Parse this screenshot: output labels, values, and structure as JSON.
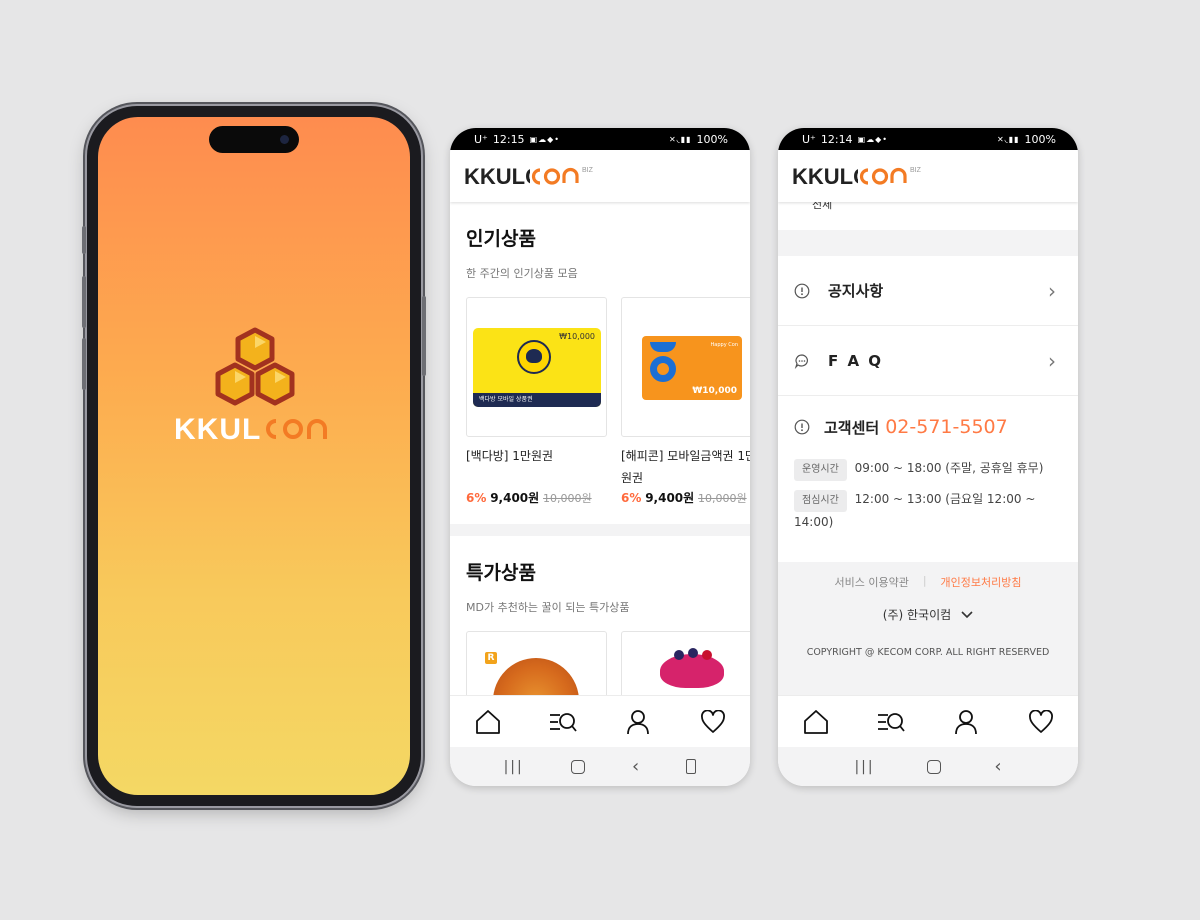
{
  "splash": {
    "brand": "KKULCON"
  },
  "screen2": {
    "status": {
      "carrier": "U⁺",
      "time": "12:15",
      "battery": "100%"
    },
    "logo": {
      "text": "KKULCON",
      "suffix": "BIZ"
    },
    "popular": {
      "title": "인기상품",
      "subtitle": "한 주간의 인기상품 모음",
      "products": [
        {
          "name": "[백다방] 1만원권",
          "discount": "6%",
          "price": "9,400원",
          "original": "10,000원",
          "card_amount": "₩10,000",
          "card_caption": "백다방 모바일 상품권",
          "card_color": "#fbe316"
        },
        {
          "name": "[해피콘] 모바일금액권 1만원권",
          "discount": "6%",
          "price": "9,400원",
          "original": "10,000원",
          "card_amount": "₩10,000",
          "card_brand": "Happy Con",
          "card_color": "#f7941d"
        }
      ]
    },
    "special": {
      "title": "특가상품",
      "subtitle": "MD가 추천하는 꿀이 되는 특가상품",
      "badge": "R"
    }
  },
  "screen3": {
    "status": {
      "carrier": "U⁺",
      "time": "12:14",
      "battery": "100%"
    },
    "logo": {
      "text": "KKULCON",
      "suffix": "BIZ"
    },
    "partial_text": "전체",
    "menu": [
      {
        "label": "공지사항"
      },
      {
        "label": "F A Q"
      }
    ],
    "cs": {
      "label": "고객센터",
      "phone": "02-571-5507",
      "hours": [
        {
          "tag": "운영시간",
          "text": "09:00 ~ 18:00 (주말, 공휴일 휴무)"
        },
        {
          "tag": "점심시간",
          "text": "12:00 ~ 13:00 (금요일 12:00 ~ 14:00)"
        }
      ]
    },
    "footer": {
      "terms": "서비스 이용약관",
      "privacy": "개인정보처리방침",
      "company": "(주) 한국이컴",
      "copyright": "COPYRIGHT @ KECOM CORP. ALL RIGHT RESERVED"
    }
  },
  "colors": {
    "accent": "#ff7a45",
    "hex_dark": "#a2321f",
    "hex_gold": "#f3b21c"
  }
}
